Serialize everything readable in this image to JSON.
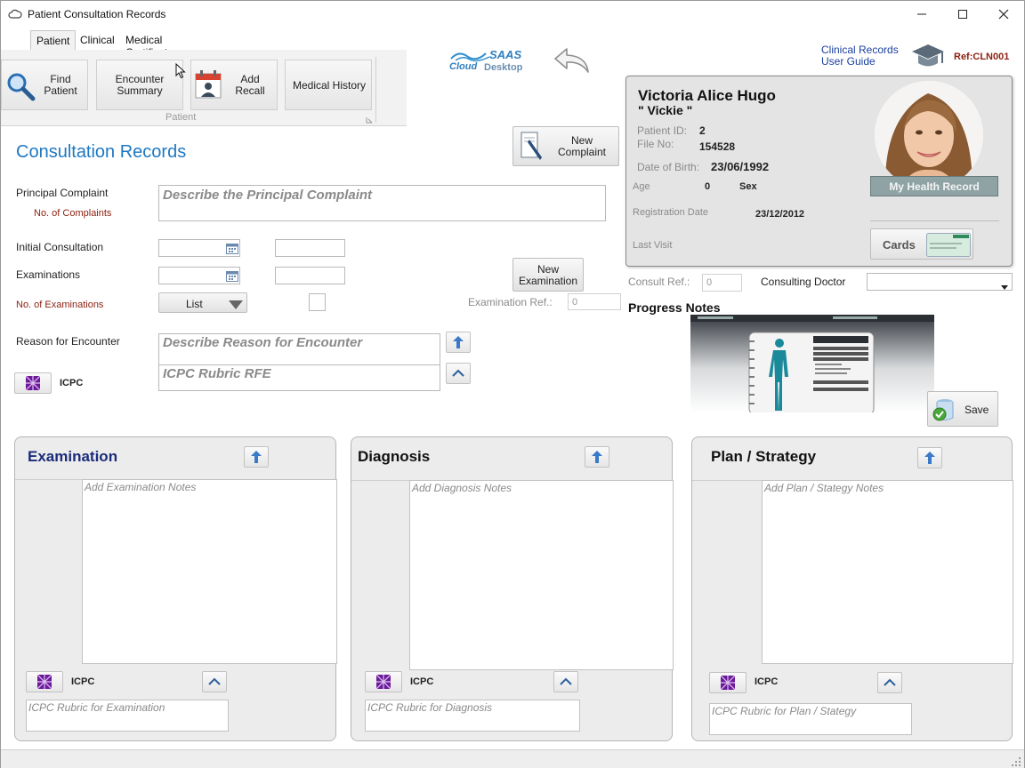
{
  "window": {
    "title": "Patient Consultation Records",
    "minimize": "—",
    "maximize": "☐",
    "close": "✕"
  },
  "tabs": [
    "Patient",
    "Clinical",
    "Medical Certificate"
  ],
  "ribbon": {
    "find_patient": [
      "Find",
      "Patient"
    ],
    "encounter_summary": [
      "Encounter",
      "Summary"
    ],
    "add_recall": [
      "Add",
      "Recall"
    ],
    "medical_history": "Medical History",
    "group_label": "Patient"
  },
  "brand": {
    "line1": "SAAS",
    "line2a": "Cloud",
    "line2b": "Desktop"
  },
  "guide": {
    "line1": "Clinical Records",
    "line2": "User Guide",
    "ref": "Ref:CLN001"
  },
  "consultation": {
    "heading": "Consultation Records",
    "new_complaint": [
      "New",
      "Complaint"
    ],
    "principal_complaint_label": "Principal Complaint",
    "no_complaints_label": "No. of Complaints",
    "principal_complaint_placeholder": "Describe the Principal Complaint",
    "initial_consultation_label": "Initial Consultation",
    "examinations_label": "Examinations",
    "no_examinations_label": "No. of Examinations",
    "list_label": "List",
    "new_examination": [
      "New",
      "Examination"
    ],
    "examination_ref_label": "Examination Ref.:",
    "examination_ref_value": "0",
    "reason_label": "Reason for Encounter",
    "reason_placeholder": "Describe Reason for Encounter",
    "icpc_rfe_placeholder": "ICPC Rubric RFE",
    "icpc_label": "ICPC"
  },
  "patient": {
    "name": "Victoria Alice Hugo",
    "nickname": "\" Vickie \"",
    "id_label": "Patient ID:",
    "id": "2",
    "file_label": "File No:",
    "file": "154528",
    "dob_label": "Date of Birth:",
    "dob": "23/06/1992",
    "age_label": "Age",
    "age": "0",
    "sex_label": "Sex",
    "sex": "",
    "reg_label": "Registration Date",
    "reg": "23/12/2012",
    "last_visit_label": "Last Visit",
    "last_visit": "",
    "health_record": "My Health Record",
    "cards": "Cards"
  },
  "consult": {
    "ref_label": "Consult Ref.:",
    "ref_value": "0",
    "doctor_label": "Consulting Doctor",
    "doctor_value": ""
  },
  "progress": {
    "heading": "Progress Notes",
    "save": "Save"
  },
  "panels": {
    "examination": {
      "title": "Examination",
      "notes_placeholder": "Add Examination Notes",
      "icpc": "ICPC",
      "rubric_placeholder": "ICPC Rubric for Examination"
    },
    "diagnosis": {
      "title": "Diagnosis",
      "notes_placeholder": "Add Diagnosis Notes",
      "icpc": "ICPC",
      "rubric_placeholder": "ICPC Rubric for Diagnosis"
    },
    "plan": {
      "title": "Plan / Strategy",
      "notes_placeholder": "Add Plan / Stategy Notes",
      "icpc": "ICPC",
      "rubric_placeholder": "ICPC Rubric for Plan / Stategy"
    }
  },
  "colors": {
    "accent": "#1e78c2",
    "red_label": "#8b1e0e",
    "panel_title_blue": "#1a2c7a",
    "health_btn": "#8fa3a5"
  }
}
